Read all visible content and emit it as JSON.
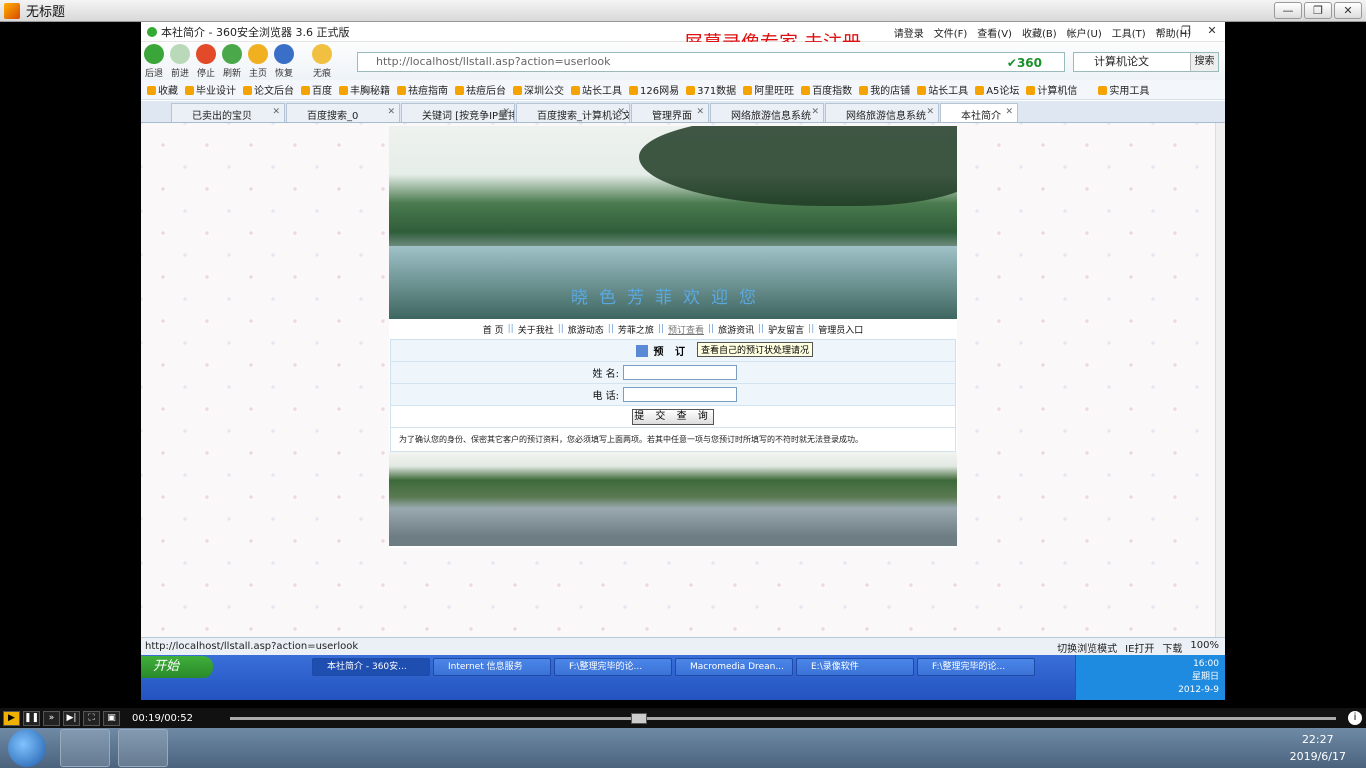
{
  "player": {
    "title": "无标题",
    "time": "00:19/00:52",
    "progress": 0.37
  },
  "browser": {
    "title": "本社简介 - 360安全浏览器 3.6 正式版",
    "watermark": "屏幕录像专家 未注册",
    "menu": [
      "请登录",
      "文件(F)",
      "查看(V)",
      "收藏(B)",
      "帐户(U)",
      "工具(T)",
      "帮助(H)"
    ],
    "nav": [
      "后退",
      "前进",
      "停止",
      "刷新",
      "主页",
      "恢复",
      "无痕"
    ],
    "address": "http://localhost/llstall.asp?action=userlook",
    "search": "计算机论文",
    "search_button": "搜索",
    "favorites": [
      "收藏",
      "毕业设计",
      "论文后台",
      "百度",
      "丰胸秘籍",
      "祛痘指南",
      "祛痘后台",
      "深圳公交",
      "站长工具",
      "126网易",
      "371数据",
      "阿里旺旺",
      "百度指数",
      "我的店铺",
      "站长工具",
      "A5论坛",
      "计算机信",
      "实用工具"
    ],
    "tabs": [
      "已卖出的宝贝",
      "百度搜索_0",
      "关键词 [按竞争IP量排...",
      "百度搜索_计算机论文",
      "管理界面",
      "网络旅游信息系统",
      "网络旅游信息系统",
      "本社简介"
    ],
    "status": "http://localhost/llstall.asp?action=userlook",
    "status_right": [
      "切换浏览模式",
      "IE打开",
      "下载",
      "100%"
    ]
  },
  "site": {
    "banner_text": "晓色芳菲欢迎您",
    "nav": [
      "首 页",
      "关于我社",
      "旅游动态",
      "芳菲之旅",
      "预订查看",
      "旅游资讯",
      "驴友留言",
      "管理员入口"
    ],
    "form_title": "预 订 管",
    "tooltip": "查看自己的预订状处理请况",
    "name_label": "姓  名:",
    "phone_label": "电  话:",
    "submit": "提 交 查 询",
    "note": "为了确认您的身份、保密其它客户的预订资料，您必须填写上面两项。若其中任意一项与您预订时所填写的不符时就无法登录成功。"
  },
  "xp_taskbar": {
    "start": "开始",
    "items": [
      "本社简介 - 360安...",
      "Internet 信息服务",
      "F:\\整理完毕的论...",
      "Macromedia Drean...",
      "E:\\录像软件",
      "F:\\整理完毕的论..."
    ],
    "time": "16:00",
    "weekday": "星期日",
    "date": "2012-9-9"
  },
  "win_taskbar": {
    "time": "22:27",
    "date": "2019/6/17"
  }
}
